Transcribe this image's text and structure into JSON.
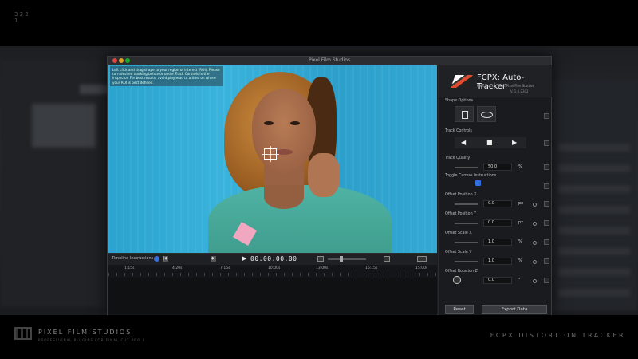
{
  "corner_mark": "3 2 2 1",
  "window": {
    "title": "Pixel Film Studios"
  },
  "viewer": {
    "instructions": "Left click and drag shape to your region of interest (ROI). Please turn desired tracking behavior under Track Controls in the inspector. For best results, avoid playhead to a time on where your ROI is best defined."
  },
  "timeline": {
    "label": "Timeline Instructions",
    "play_icon": "play-icon",
    "timecode": "00:00:00:00",
    "ticks": [
      "1:15s",
      "4:20s",
      "7:15s",
      "10:00s",
      "13:00s",
      "16:15s",
      "15:00s"
    ]
  },
  "panel": {
    "logo_title": "FCPX: Auto-Tracker",
    "logo_sub": "Pixel Tracker from Pixel Film Studios",
    "logo_version": "V. 1.0.2302",
    "shape_options_label": "Shape Options",
    "track_controls_label": "Track Controls",
    "track_buttons": [
      "◀",
      "■",
      "▶"
    ],
    "track_quality_label": "Track Quality",
    "track_quality_value": "50.0",
    "track_quality_unit": "%",
    "toggle_label": "Toggle Canvas Instructions",
    "params": [
      {
        "label": "Offset Position X",
        "value": "0.0",
        "unit": "px"
      },
      {
        "label": "Offset Position Y",
        "value": "0.0",
        "unit": "px"
      },
      {
        "label": "Offset Scale X",
        "value": "1.0",
        "unit": "%"
      },
      {
        "label": "Offset Scale Y",
        "value": "1.0",
        "unit": "%"
      },
      {
        "label": "Offset Rotation Z",
        "value": "0.0",
        "unit": "°"
      }
    ],
    "reset_label": "Reset",
    "export_label": "Export Data"
  },
  "branding": {
    "company": "PIXEL FILM STUDIOS",
    "company_sub": "PROFESSIONAL PLUGINS FOR FINAL CUT PRO X",
    "product": "FCPX DISTORTION TRACKER"
  },
  "colors": {
    "accent_blue": "#2f6fe0",
    "wall_blue": "#33a9d4",
    "shirt_teal": "#4fb3a3"
  }
}
